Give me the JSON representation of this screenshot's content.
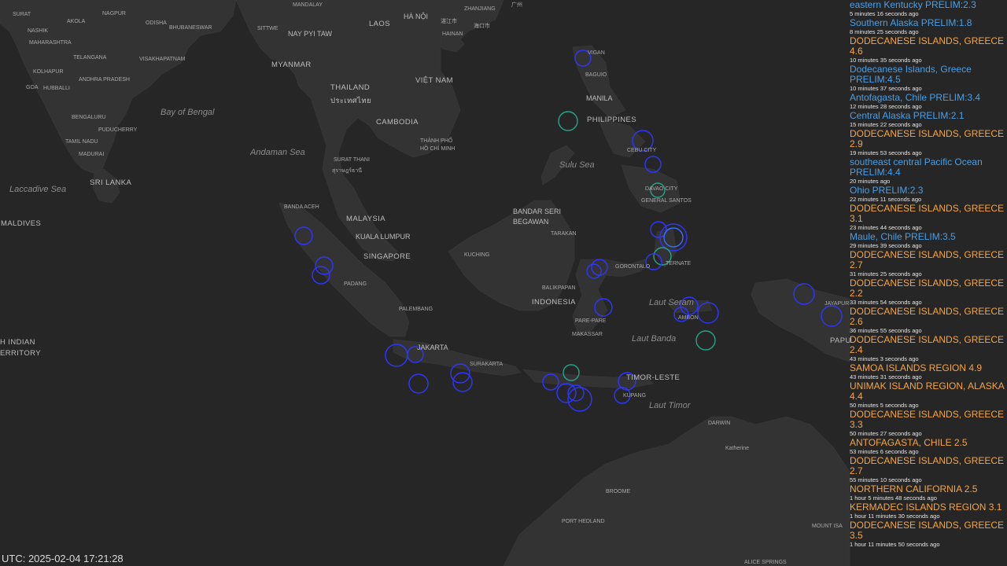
{
  "map": {
    "sea_labels": [
      "Bay of Bengal",
      "Andaman Sea",
      "Laccadive Sea",
      "Sulu Sea",
      "Laut Seram",
      "Laut Banda",
      "Laut Timor"
    ],
    "country_labels": [
      "MYANMAR",
      "LAOS",
      "THAILAND",
      "VIỆT NAM",
      "CAMBODIA",
      "PHILIPPINES",
      "MALAYSIA",
      "SINGAPORE",
      "INDONESIA",
      "SRI LANKA",
      "MALDIVES",
      "TIMOR-LESTE",
      "PAPU",
      "H INDIAN",
      "ERRITORY",
      "ประเทศไทย"
    ],
    "city_labels": [
      "SURAT",
      "AKOLA",
      "ODISHA",
      "NASHIK",
      "NAGPUR",
      "BHUBANESWAR",
      "MAHARASHTRA",
      "TELANGANA",
      "VISAKHAPATNAM",
      "KOLHAPUR",
      "ANDHRA PRADESH",
      "GOA",
      "HUBBALLI",
      "BENGALURU",
      "PUDUCHERRY",
      "TAMIL NADU",
      "MADURAI",
      "MANDALAY",
      "SITTWE",
      "HAINAN",
      "ZHANJIANG",
      "BANDA ACEH",
      "PADANG",
      "PALEMBANG",
      "SURAKARTA",
      "SURAT THANI",
      "สุราษฎร์ธานี",
      "THÀNH PHỐ HỒ CHÍ MINH",
      "KUCHING",
      "TARAKAN",
      "BALIKPAPAN",
      "PARE-PARE",
      "MAKASSAR",
      "GORONTALO",
      "TERNATE",
      "AMBON",
      "JAYAPUR",
      "KUPANG",
      "BAGUIO",
      "VIGAN",
      "CEBU CITY",
      "DAVAO CITY",
      "GENERAL SANTOS",
      "DARWIN",
      "Katherine",
      "BROOME",
      "PORT HEDLAND",
      "MOUNT ISA",
      "ALICE SPRINGS",
      "海口市",
      "湛江市",
      "广州"
    ],
    "capital_labels": [
      "NAY PYI TAW",
      "HÀ NỘI",
      "MANILA",
      "BANDAR SERI BEGAWAN",
      "KUALA LUMPUR",
      "JAKARTA"
    ],
    "colors": {
      "ocean": "#262626",
      "land": "#333333",
      "marker_blue": "#2f36ff",
      "marker_teal": "#23a58a",
      "feed_orange": "#f5a547",
      "feed_blue": "#4a9fe6"
    },
    "markers_note": "blue and teal earthquake circles"
  },
  "feed": [
    {
      "title": "eastern Kentucky PRELIM:2.3",
      "ago": "5 minutes 16 seconds ago",
      "color": "blue"
    },
    {
      "title": "Southern Alaska PRELIM:1.8",
      "ago": "8 minutes 25 seconds ago",
      "color": "blue"
    },
    {
      "title": "DODECANESE ISLANDS, GREECE 4.6",
      "ago": "10 minutes 35 seconds ago",
      "color": "orange"
    },
    {
      "title": "Dodecanese Islands, Greece PRELIM:4.5",
      "ago": "10 minutes 37 seconds ago",
      "color": "blue"
    },
    {
      "title": "Antofagasta, Chile PRELIM:3.4",
      "ago": "12 minutes 28 seconds ago",
      "color": "blue"
    },
    {
      "title": "Central Alaska PRELIM:2.1",
      "ago": "15 minutes 22 seconds ago",
      "color": "blue"
    },
    {
      "title": "DODECANESE ISLANDS, GREECE 2.9",
      "ago": "19 minutes 53 seconds ago",
      "color": "orange"
    },
    {
      "title": "southeast central Pacific Ocean PRELIM:4.4",
      "ago": "20 minutes ago",
      "color": "blue"
    },
    {
      "title": "Ohio PRELIM:2.3",
      "ago": "22 minutes 11 seconds ago",
      "color": "blue"
    },
    {
      "title": "DODECANESE ISLANDS, GREECE 3.1",
      "ago": "23 minutes 44 seconds ago",
      "color": "orange"
    },
    {
      "title": "Maule, Chile PRELIM:3.5",
      "ago": "29 minutes 39 seconds ago",
      "color": "blue"
    },
    {
      "title": "DODECANESE ISLANDS, GREECE 2.7",
      "ago": "31 minutes 25 seconds ago",
      "color": "orange"
    },
    {
      "title": "DODECANESE ISLANDS, GREECE 2.2",
      "ago": "33 minutes 54 seconds ago",
      "color": "orange"
    },
    {
      "title": "DODECANESE ISLANDS, GREECE 2.6",
      "ago": "36 minutes 55 seconds ago",
      "color": "orange"
    },
    {
      "title": "DODECANESE ISLANDS, GREECE 2.4",
      "ago": "43 minutes 3 seconds ago",
      "color": "orange"
    },
    {
      "title": "SAMOA ISLANDS REGION 4.9",
      "ago": "43 minutes 31 seconds ago",
      "color": "orange"
    },
    {
      "title": "UNIMAK ISLAND REGION, ALASKA 4.4",
      "ago": "50 minutes 5 seconds ago",
      "color": "orange"
    },
    {
      "title": "DODECANESE ISLANDS, GREECE 3.3",
      "ago": "50 minutes 27 seconds ago",
      "color": "orange"
    },
    {
      "title": "ANTOFAGASTA, CHILE 2.5",
      "ago": "53 minutes 6 seconds ago",
      "color": "orange"
    },
    {
      "title": "DODECANESE ISLANDS, GREECE 2.7",
      "ago": "55 minutes 10 seconds ago",
      "color": "orange"
    },
    {
      "title": "NORTHERN CALIFORNIA 2.5",
      "ago": "1 hour 5 minutes 48 seconds ago",
      "color": "orange"
    },
    {
      "title": "KERMADEC ISLANDS REGION 3.1",
      "ago": "1 hour 11 minutes 30 seconds ago",
      "color": "orange"
    },
    {
      "title": "DODECANESE ISLANDS, GREECE 3.5",
      "ago": "1 hour 11 minutes 50 seconds ago",
      "color": "orange"
    }
  ],
  "utc": "UTC: 2025-02-04 17:21:28"
}
